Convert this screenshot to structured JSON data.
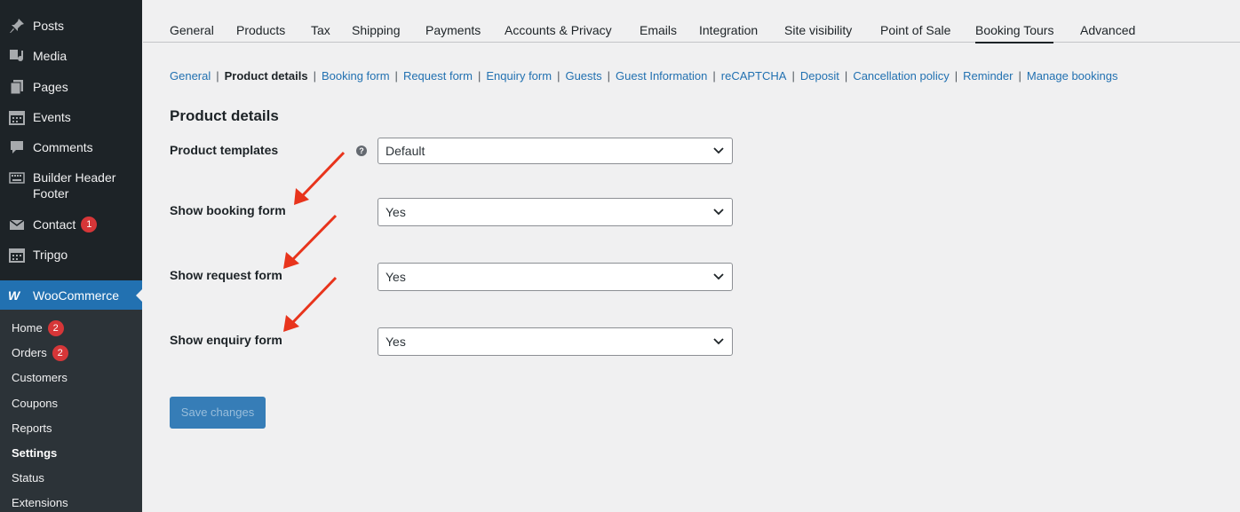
{
  "sidebar": {
    "items": [
      {
        "label": "Posts",
        "icon": "pin-icon"
      },
      {
        "label": "Media",
        "icon": "media-icon"
      },
      {
        "label": "Pages",
        "icon": "pages-icon"
      },
      {
        "label": "Events",
        "icon": "calendar-icon"
      },
      {
        "label": "Comments",
        "icon": "comment-icon"
      },
      {
        "label": "Builder Header Footer",
        "icon": "keyboard-icon"
      },
      {
        "label": "Contact",
        "icon": "mail-icon",
        "badge": "1"
      },
      {
        "label": "Tripgo",
        "icon": "calendar-icon"
      }
    ],
    "woocommerce": {
      "label": "WooCommerce",
      "icon": "woo-icon"
    },
    "submenu": [
      {
        "label": "Home",
        "badge": "2"
      },
      {
        "label": "Orders",
        "badge": "2"
      },
      {
        "label": "Customers"
      },
      {
        "label": "Coupons"
      },
      {
        "label": "Reports"
      },
      {
        "label": "Settings",
        "current": true
      },
      {
        "label": "Status"
      },
      {
        "label": "Extensions"
      }
    ]
  },
  "tabs": [
    "General",
    "Products",
    "Tax",
    "Shipping",
    "Payments",
    "Accounts & Privacy",
    "Emails",
    "Integration",
    "Site visibility",
    "Point of Sale",
    "Booking Tours",
    "Advanced"
  ],
  "active_tab": "Booking Tours",
  "subnav": [
    "General",
    "Product details",
    "Booking form",
    "Request form",
    "Enquiry form",
    "Guests",
    "Guest Information",
    "reCAPTCHA",
    "Deposit",
    "Cancellation policy",
    "Reminder",
    "Manage bookings"
  ],
  "subnav_current": "Product details",
  "section_title": "Product details",
  "fields": {
    "product_templates": {
      "label": "Product templates",
      "value": "Default",
      "help": "?"
    },
    "show_booking_form": {
      "label": "Show booking form",
      "value": "Yes"
    },
    "show_request_form": {
      "label": "Show request form",
      "value": "Yes"
    },
    "show_enquiry_form": {
      "label": "Show enquiry form",
      "value": "Yes"
    }
  },
  "save_label": "Save changes",
  "colors": {
    "accent": "#2271b1",
    "annotation_arrow": "#e8341c",
    "badge": "#d63638"
  }
}
